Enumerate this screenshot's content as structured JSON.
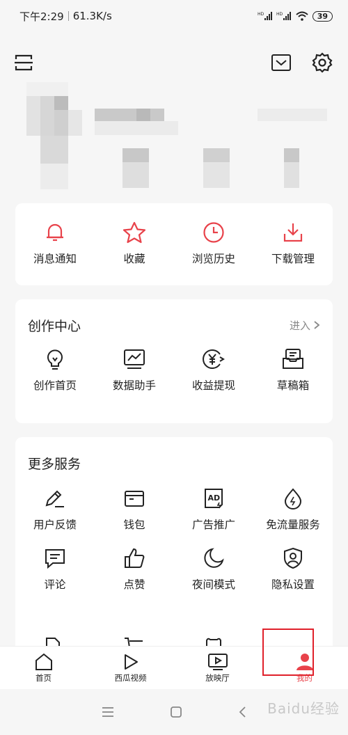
{
  "status_bar": {
    "time": "下午2:29",
    "speed": "61.3K/s",
    "battery": "39"
  },
  "quick_actions": [
    {
      "label": "消息通知",
      "icon": "bell-icon"
    },
    {
      "label": "收藏",
      "icon": "star-icon"
    },
    {
      "label": "浏览历史",
      "icon": "clock-icon"
    },
    {
      "label": "下载管理",
      "icon": "download-icon"
    }
  ],
  "creation_center": {
    "title": "创作中心",
    "enter_label": "进入",
    "items": [
      {
        "label": "创作首页",
        "icon": "lightbulb-icon"
      },
      {
        "label": "数据助手",
        "icon": "chart-icon"
      },
      {
        "label": "收益提现",
        "icon": "yuan-icon"
      },
      {
        "label": "草稿箱",
        "icon": "draft-box-icon"
      }
    ]
  },
  "more_services": {
    "title": "更多服务",
    "row1": [
      {
        "label": "用户反馈",
        "icon": "pen-icon"
      },
      {
        "label": "钱包",
        "icon": "wallet-icon"
      },
      {
        "label": "广告推广",
        "icon": "ad-icon"
      },
      {
        "label": "免流量服务",
        "icon": "drop-icon"
      }
    ],
    "row2": [
      {
        "label": "评论",
        "icon": "comment-icon"
      },
      {
        "label": "点赞",
        "icon": "thumbs-up-icon"
      },
      {
        "label": "夜间模式",
        "icon": "moon-icon"
      },
      {
        "label": "隐私设置",
        "icon": "shield-user-icon"
      }
    ]
  },
  "tabbar": [
    {
      "label": "首页",
      "icon": "home-icon"
    },
    {
      "label": "西瓜视频",
      "icon": "play-icon"
    },
    {
      "label": "放映厅",
      "icon": "tv-icon"
    },
    {
      "label": "我的",
      "icon": "user-icon",
      "active": true
    }
  ],
  "watermark": "Baidu经验",
  "colors": {
    "accent_red": "#e8424a",
    "highlight_box": "#e0202a"
  }
}
